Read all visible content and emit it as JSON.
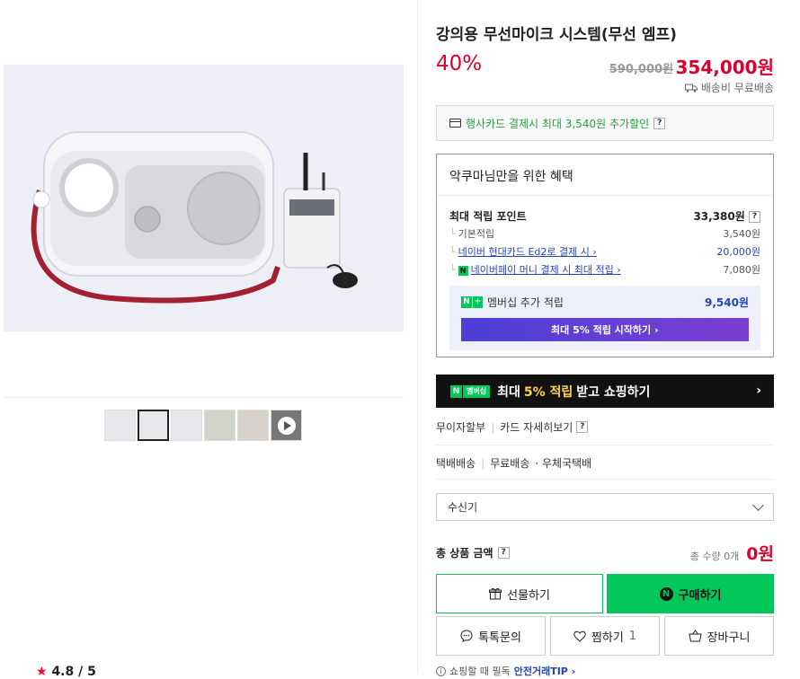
{
  "product": {
    "title": "강의용 무선마이크 시스템(무선 엠프)",
    "discount": "40%",
    "original_price": "590,000원",
    "price": "354,000원",
    "shipping": "배송비 무료배송"
  },
  "card_offer": {
    "text": "행사카드 결제시 최대 3,540원 추가할인",
    "help": "?"
  },
  "benefits": {
    "title": "악쿠마님만을 위한 혜택",
    "rows": [
      {
        "label": "최대 적립 포인트",
        "value": "33,380원",
        "help": "?"
      },
      {
        "label": "기본적립",
        "value": "3,540원"
      },
      {
        "label": "네이버 현대카드 Ed2로 결제 시 ›",
        "value": "20,000원"
      },
      {
        "label": "네이버페이 머니 결제 시 최대 적립 ›",
        "value": "7,080원"
      }
    ],
    "membership": {
      "label": "멤버십 추가 적립",
      "value": "9,540원",
      "button": "최대 5% 적립 시작하기 ›"
    }
  },
  "banner": {
    "badge_n": "N",
    "badge_member": "멤버십",
    "text_pre": "최대",
    "highlight": "5% 적립",
    "text_post": "받고 쇼핑하기",
    "chevron": "›"
  },
  "installment": {
    "label": "무이자할부",
    "link": "카드 자세히보기",
    "help": "?"
  },
  "delivery": {
    "label": "택배배송",
    "fee": "무료배송",
    "courier": "· 우체국택배"
  },
  "option_select": {
    "value": "수신기"
  },
  "total": {
    "label": "총 상품 금액",
    "help": "?",
    "qty": "총 수량 0개",
    "amount": "0원"
  },
  "buttons": {
    "gift": "선물하기",
    "buy": "구매하기",
    "talk": "톡톡문의",
    "wish": "찜하기",
    "wish_count": "1",
    "cart": "장바구니"
  },
  "tip": {
    "text": "쇼핑할 때 필독",
    "link": "안전거래TIP ›"
  },
  "rating": {
    "star": "★",
    "score": "4.8",
    "slash": "/ 5"
  },
  "colors": {
    "accent_red": "#d9022f",
    "naver_green": "#03c75a",
    "link_blue": "#2744b3"
  }
}
